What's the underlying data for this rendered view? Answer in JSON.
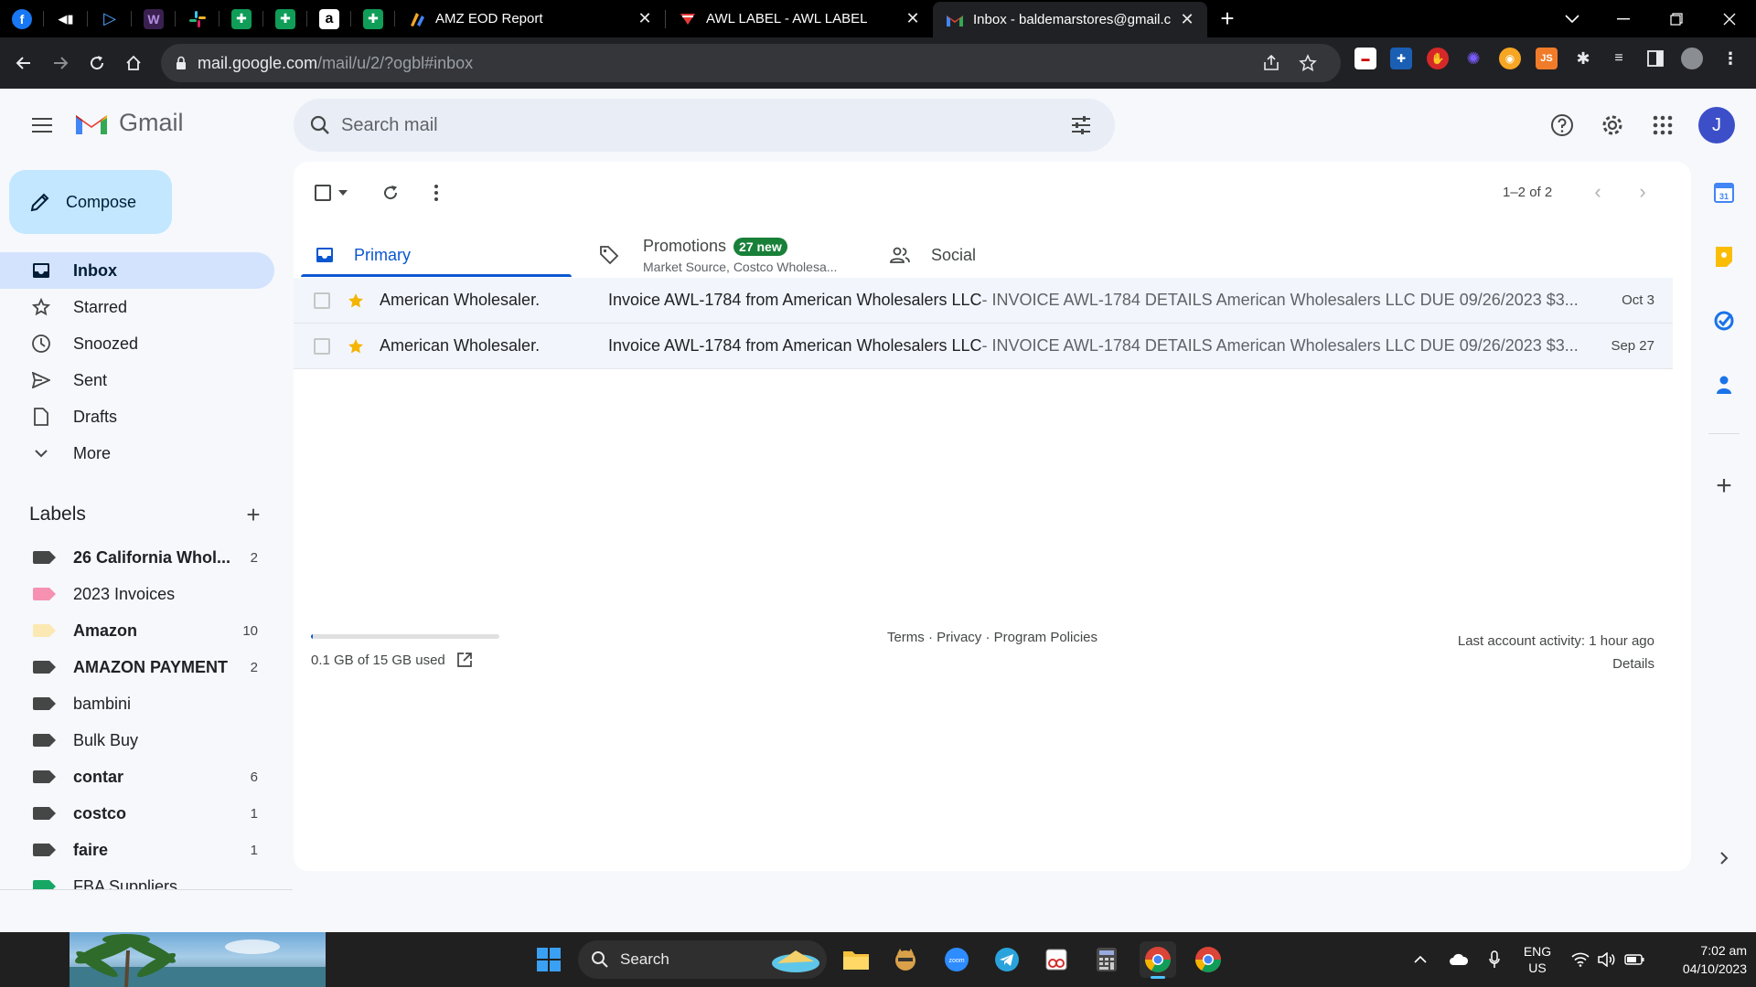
{
  "browser": {
    "pinned_tabs": [
      {
        "icon": "facebook-icon",
        "glyph": "f",
        "color": "#1877f2"
      },
      {
        "icon": "audio-icon",
        "glyph": "◄",
        "color": "#000000"
      },
      {
        "icon": "play-icon",
        "glyph": "▷",
        "color": "#000000"
      },
      {
        "icon": "w-app-icon",
        "glyph": "W",
        "color": "#5b2d8c"
      },
      {
        "icon": "slack-icon",
        "glyph": "#",
        "color": "#000000"
      },
      {
        "icon": "sheets-icon",
        "glyph": "+",
        "color": "#0f9d58"
      },
      {
        "icon": "sheets-icon",
        "glyph": "+",
        "color": "#0f9d58"
      },
      {
        "icon": "amazon-icon",
        "glyph": "a",
        "color": "#000000"
      },
      {
        "icon": "sheets-icon",
        "glyph": "+",
        "color": "#0f9d58"
      }
    ],
    "tabs": [
      {
        "title": "AMZ EOD Report",
        "icon": "report-icon",
        "active": false
      },
      {
        "title": "AWL LABEL - AWL LABEL",
        "icon": "awl-icon",
        "active": false
      },
      {
        "title": "Inbox - baldemarstores@gmail.c",
        "icon": "gmail-icon",
        "active": true
      }
    ],
    "url_host": "mail.google.com",
    "url_path": "/mail/u/2/?ogbl#inbox"
  },
  "gmail": {
    "app_name": "Gmail",
    "search_placeholder": "Search mail",
    "avatar_initial": "J",
    "compose_label": "Compose",
    "nav": [
      {
        "label": "Inbox",
        "icon": "inbox-icon",
        "active": true
      },
      {
        "label": "Starred",
        "icon": "star-icon",
        "active": false
      },
      {
        "label": "Snoozed",
        "icon": "clock-icon",
        "active": false
      },
      {
        "label": "Sent",
        "icon": "send-icon",
        "active": false
      },
      {
        "label": "Drafts",
        "icon": "draft-icon",
        "active": false
      },
      {
        "label": "More",
        "icon": "chevron-down-icon",
        "active": false
      }
    ],
    "labels_title": "Labels",
    "labels": [
      {
        "name": "26 California Whol...",
        "count": "2",
        "color": "#444746",
        "bold": true
      },
      {
        "name": "2023 Invoices",
        "count": "",
        "color": "#f691b2",
        "bold": false
      },
      {
        "name": "Amazon",
        "count": "10",
        "color": "#fce8b2",
        "bold": true
      },
      {
        "name": "AMAZON PAYMENT",
        "count": "2",
        "color": "#444746",
        "bold": true
      },
      {
        "name": "bambini",
        "count": "",
        "color": "#444746",
        "bold": false
      },
      {
        "name": "Bulk Buy",
        "count": "",
        "color": "#444746",
        "bold": false
      },
      {
        "name": "contar",
        "count": "6",
        "color": "#444746",
        "bold": true
      },
      {
        "name": "costco",
        "count": "1",
        "color": "#444746",
        "bold": true
      },
      {
        "name": "faire",
        "count": "1",
        "color": "#444746",
        "bold": true
      },
      {
        "name": "FBA Suppliers",
        "count": "",
        "color": "#16a765",
        "bold": false
      }
    ],
    "pager": "1–2 of 2",
    "categories": [
      {
        "name": "Primary",
        "icon": "inbox-icon"
      },
      {
        "name": "Promotions",
        "icon": "tag-icon",
        "badge": "27 new",
        "sub": "Market Source, Costco Wholesa..."
      },
      {
        "name": "Social",
        "icon": "people-icon"
      }
    ],
    "emails": [
      {
        "sender": "American Wholesaler.",
        "subject": "Invoice AWL-1784 from American Wholesalers LLC",
        "snippet": " - INVOICE AWL-1784 DETAILS American Wholesalers LLC DUE 09/26/2023 $3...",
        "date": "Oct 3",
        "starred": true
      },
      {
        "sender": "American Wholesaler.",
        "subject": "Invoice AWL-1784 from American Wholesalers LLC",
        "snippet": " - INVOICE AWL-1784 DETAILS American Wholesalers LLC DUE 09/26/2023 $3...",
        "date": "Sep 27",
        "starred": true
      }
    ],
    "footer": {
      "storage": "0.1 GB of 15 GB used",
      "storage_fraction": 0.01,
      "links": "Terms · Privacy · Program Policies",
      "activity": "Last account activity: 1 hour ago",
      "details": "Details"
    }
  },
  "taskbar": {
    "search_label": "Search",
    "lang_top": "ENG",
    "lang_bottom": "US",
    "time": "7:02 am",
    "date": "04/10/2023"
  },
  "colors": {
    "accent": "#0b57d0",
    "compose_bg": "#c2e7ff",
    "active_nav_bg": "#d3e3fd",
    "star": "#f4b400",
    "badge_green": "#188038"
  }
}
